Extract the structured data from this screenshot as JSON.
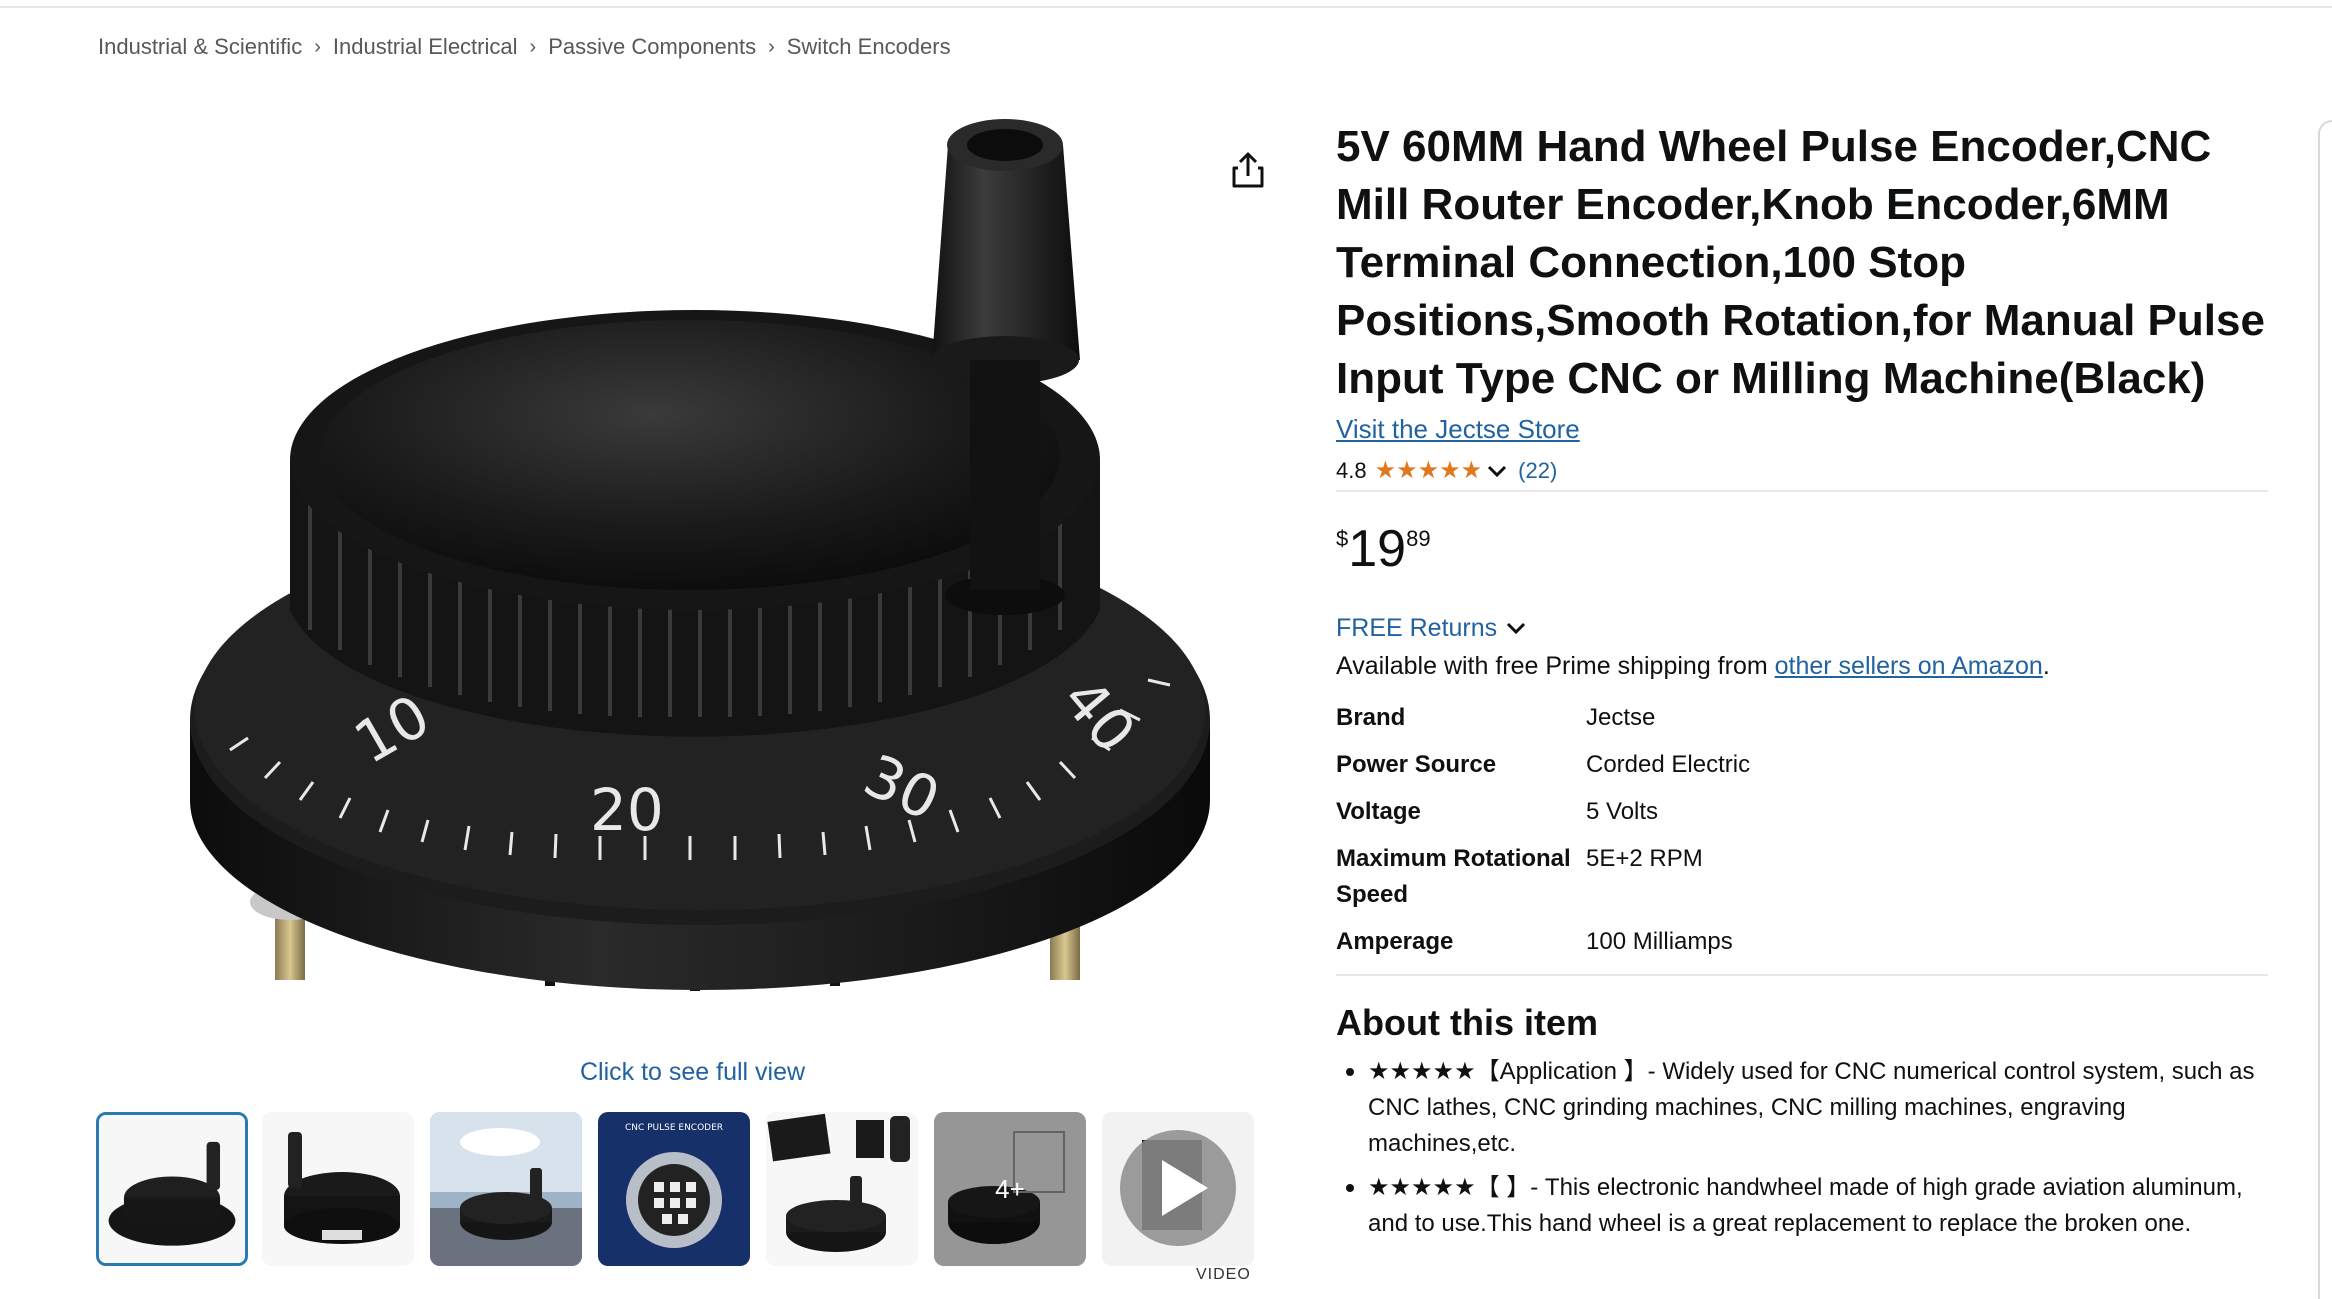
{
  "breadcrumb": {
    "items": [
      "Industrial & Scientific",
      "Industrial Electrical",
      "Passive Components",
      "Switch Encoders"
    ],
    "separator": "›"
  },
  "gallery": {
    "full_view_label": "Click to see full view",
    "more_count_label": "4+",
    "video_label": "VIDEO",
    "thumb3_text": "CNC PULSE ENCODER"
  },
  "product": {
    "title": "5V 60MM Hand Wheel Pulse Encoder,CNC Mill Router Encoder,Knob Encoder,6MM Terminal Connection,100 Stop Positions,Smooth Rotation,for Manual Pulse Input Type CNC or Milling Machine(Black)",
    "store_link": "Visit the Jectse Store",
    "rating_value": "4.8",
    "rating_stars": 4.8,
    "rating_count": "(22)",
    "price_symbol": "$",
    "price_whole": "19",
    "price_fraction": "89",
    "returns_label": "FREE Returns",
    "prime_text": "Available with free Prime shipping from ",
    "prime_link": "other sellers on Amazon",
    "prime_suffix": "."
  },
  "specs": [
    {
      "key": "Brand",
      "value": "Jectse"
    },
    {
      "key": "Power Source",
      "value": "Corded Electric"
    },
    {
      "key": "Voltage",
      "value": "5 Volts"
    },
    {
      "key": "Maximum Rotational Speed",
      "value": "5E+2 RPM"
    },
    {
      "key": "Amperage",
      "value": "100 Milliamps"
    }
  ],
  "about": {
    "title": "About this item",
    "bullets": [
      "★★★★★【Application 】- Widely used for CNC numerical control system, such as CNC lathes, CNC grinding machines, CNC milling machines, engraving machines,etc.",
      "★★★★★【 】- This electronic handwheel made of high grade aviation aluminum, and to use.This hand wheel is a great replacement to replace the broken one."
    ]
  },
  "colors": {
    "link": "#2162a1",
    "star": "#de7921",
    "text": "#0f1111",
    "thumb_selected_border": "#2a7ab0"
  }
}
